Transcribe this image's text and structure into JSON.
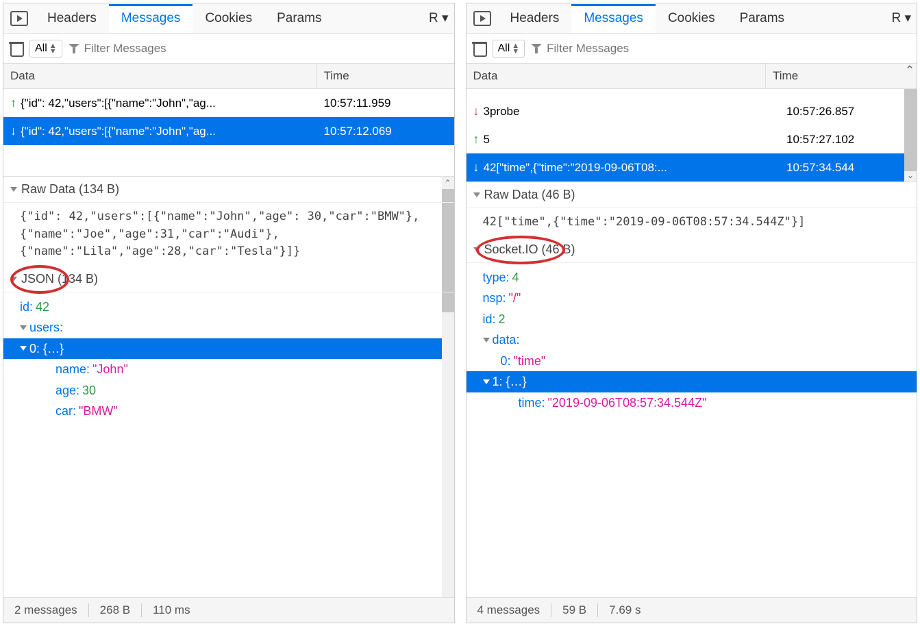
{
  "left": {
    "tabs": {
      "headers": "Headers",
      "messages": "Messages",
      "cookies": "Cookies",
      "params": "Params",
      "r": "R"
    },
    "filter": {
      "all": "All",
      "placeholder": "Filter Messages"
    },
    "columns": {
      "data": "Data",
      "time": "Time"
    },
    "messages": [
      {
        "dir": "up",
        "text": "{\"id\": 42,\"users\":[{\"name\":\"John\",\"ag...",
        "time": "10:57:11.959"
      },
      {
        "dir": "down",
        "text": "{\"id\": 42,\"users\":[{\"name\":\"John\",\"ag...",
        "time": "10:57:12.069"
      }
    ],
    "raw": {
      "header": "Raw Data (134 B)",
      "body": "{\"id\": 42,\"users\":[{\"name\":\"John\",\"age\": 30,\"car\":\"BMW\"},\n{\"name\":\"Joe\",\"age\":31,\"car\":\"Audi\"},\n{\"name\":\"Lila\",\"age\":28,\"car\":\"Tesla\"}]}"
    },
    "json_section": {
      "header": "JSON (134 B)"
    },
    "tree": {
      "id_k": "id:",
      "id_v": "42",
      "users_k": "users:",
      "node0": "0: {…}",
      "name_k": "name:",
      "name_v": "\"John\"",
      "age_k": "age:",
      "age_v": "30",
      "car_k": "car:",
      "car_v": "\"BMW\""
    },
    "status": {
      "count": "2 messages",
      "size": "268 B",
      "duration": "110 ms"
    }
  },
  "right": {
    "tabs": {
      "headers": "Headers",
      "messages": "Messages",
      "cookies": "Cookies",
      "params": "Params",
      "r": "R"
    },
    "filter": {
      "all": "All",
      "placeholder": "Filter Messages"
    },
    "columns": {
      "data": "Data",
      "time": "Time"
    },
    "messages": [
      {
        "dir": "down",
        "text": "3probe",
        "time": "10:57:26.857"
      },
      {
        "dir": "up",
        "text": "5",
        "time": "10:57:27.102"
      },
      {
        "dir": "down",
        "text": "42[\"time\",{\"time\":\"2019-09-06T08:...",
        "time": "10:57:34.544"
      }
    ],
    "raw": {
      "header": "Raw Data (46 B)",
      "body": "42[\"time\",{\"time\":\"2019-09-06T08:57:34.544Z\"}]"
    },
    "socketio_section": {
      "header": "Socket.IO (46 B)"
    },
    "tree": {
      "type_k": "type:",
      "type_v": "4",
      "nsp_k": "nsp:",
      "nsp_v": "\"/\"",
      "id_k": "id:",
      "id_v": "2",
      "data_k": "data:",
      "d0_k": "0:",
      "d0_v": "\"time\"",
      "d1_k": "1: {…}",
      "time_k": "time:",
      "time_v": "\"2019-09-06T08:57:34.544Z\""
    },
    "status": {
      "count": "4 messages",
      "size": "59 B",
      "duration": "7.69 s"
    }
  }
}
